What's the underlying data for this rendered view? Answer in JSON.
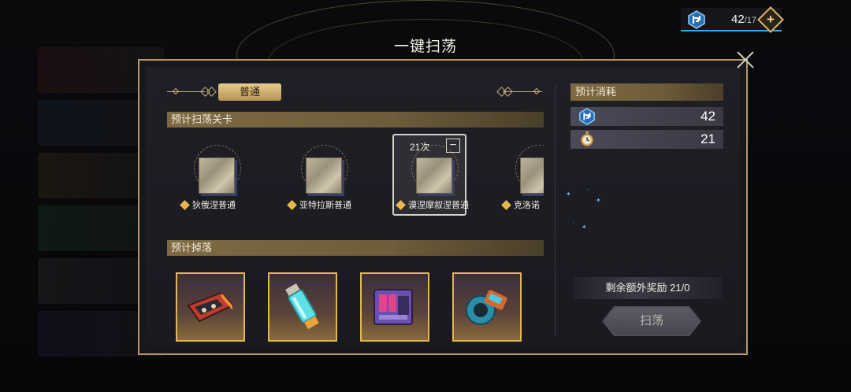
{
  "resource": {
    "value": "42",
    "max": "/17",
    "plus": "+"
  },
  "modal": {
    "title": "一键扫荡",
    "tab_label": "普通",
    "section_stages": "预计扫荡关卡",
    "section_drops": "预计掉落",
    "stages": [
      {
        "name": "狄俄涅普通"
      },
      {
        "name": "亚特拉斯普通"
      },
      {
        "name": "谟涅摩叙涅普通",
        "count": "21次",
        "selected": true
      },
      {
        "name": "克洛诺"
      }
    ],
    "minus": "−",
    "drops": [
      {
        "icon": "red-circuit-cartridge-icon"
      },
      {
        "icon": "cyan-energy-tube-icon"
      },
      {
        "icon": "purple-device-icon"
      },
      {
        "icon": "cyan-gear-module-icon"
      }
    ]
  },
  "cost_panel": {
    "title": "预计消耗",
    "rows": [
      {
        "icon": "stamina-icon",
        "value": "42"
      },
      {
        "icon": "pocket-watch-icon",
        "value": "21"
      }
    ],
    "bonus_text": "剩余额外奖励  21/0",
    "sweep_label": "扫荡"
  },
  "colors": {
    "accent_gold": "#b59a5c",
    "tab_gold": "#e6cb8e",
    "stamina_blue": "#3aa8e8"
  }
}
